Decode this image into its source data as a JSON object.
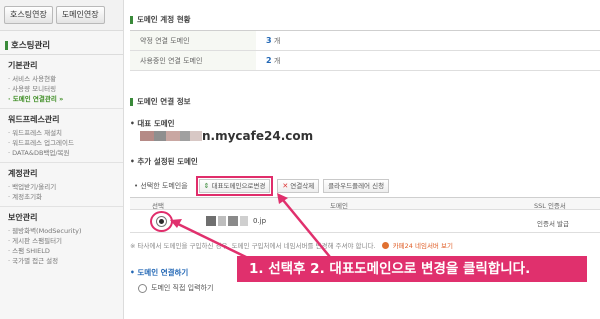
{
  "sidebar": {
    "tabs": [
      {
        "label": "호스팅연장"
      },
      {
        "label": "도메인연장"
      }
    ],
    "title": "호스팅관리",
    "groups": [
      {
        "title": "기본관리",
        "items": [
          {
            "label": "· 서비스 사용현황",
            "active": false
          },
          {
            "label": "· 사용량 모니터링",
            "active": false
          },
          {
            "label": "· 도메인 연결관리 »",
            "active": true
          }
        ]
      },
      {
        "title": "워드프레스관리",
        "items": [
          {
            "label": "· 워드프레스 재설치",
            "active": false
          },
          {
            "label": "· 워드프레스 업그레이드",
            "active": false
          },
          {
            "label": "· DATA&DB백업/복원",
            "active": false
          }
        ]
      },
      {
        "title": "계정관리",
        "items": [
          {
            "label": "· 백업받기/올리기",
            "active": false
          },
          {
            "label": "· 계정초기화",
            "active": false
          }
        ]
      },
      {
        "title": "보안관리",
        "items": [
          {
            "label": "· 웹방화벽(ModSecurity)",
            "active": false
          },
          {
            "label": "· 게시판 스팸필터기",
            "active": false
          },
          {
            "label": "· 스팸 SHIELD",
            "active": false
          },
          {
            "label": "· 국가별 접근 설정",
            "active": false
          }
        ]
      }
    ]
  },
  "main": {
    "status": {
      "title": "도메인 계정 현황",
      "rows": [
        {
          "label": "약정 연결 도메인",
          "value": "3",
          "unit": "개"
        },
        {
          "label": "사용중인 연결 도메인",
          "value": "2",
          "unit": "개"
        }
      ]
    },
    "connect_info": {
      "title": "도메인 연결 정보",
      "representative_label": "• 대표 도메인",
      "representative_domain": "n.mycafe24.com",
      "additional_label": "• 추가 설정된 도메인",
      "toolbar": {
        "select_label": "• 선택한 도메인을",
        "set_rep_label": "대표도메인으로변경",
        "delete_label": "연결삭제",
        "cloud_label": "클라우드플레어 신청"
      },
      "columns": {
        "select": "선택",
        "domain": "도메인",
        "ssl": "SSL 인증서"
      },
      "rows": [
        {
          "domain_suffix": "0.jp",
          "ssl": "인증서 발급",
          "selected": true
        }
      ],
      "notice": "※ 타사에서 도메인을 구입하신 경우, 도메인 구입처에서 네임서버를 변경해 주셔야 합니다.",
      "notice_link": "카페24 네임서버 보기"
    },
    "connect_title": "• 도메인 연결하기",
    "direct_input_label": "도메인 직접 입력하기"
  },
  "annotation": {
    "text": "1. 선택후 2. 대표도메인으로 변경을 클릭합니다.",
    "color": "#e0306d"
  },
  "colors": {
    "accent_green": "#3a8a3a",
    "active_menu": "#3e8d24",
    "link_blue": "#2267b5",
    "highlight_pink": "#e02d6b"
  }
}
